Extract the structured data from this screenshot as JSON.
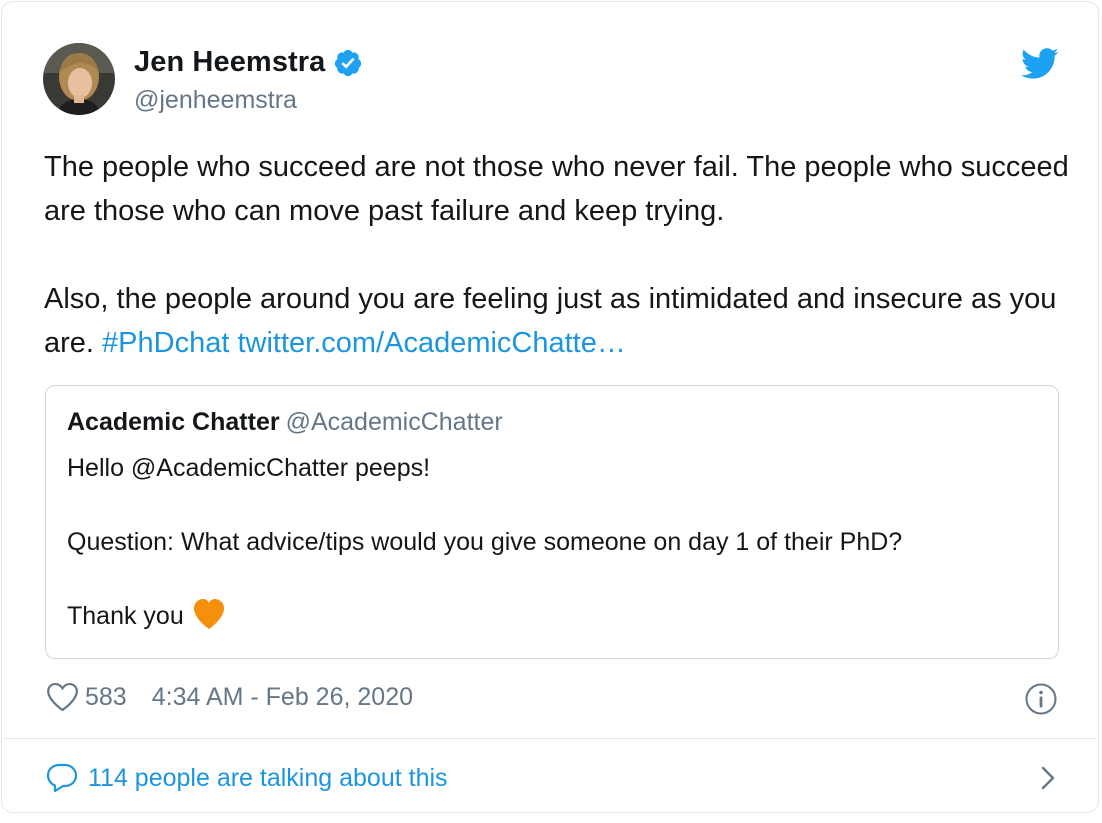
{
  "author": {
    "name": "Jen Heemstra",
    "handle": "@jenheemstra",
    "verified": true
  },
  "tweet": {
    "text_line1": "The people who succeed are not those who never fail. The people who succeed are those who can move past failure and keep trying.",
    "text_line2": "Also, the people around you are feeling just as intimidated and insecure as you are. ",
    "hashtag": "#PhDchat",
    "link": "twitter.com/AcademicChatte…"
  },
  "quoted_tweet": {
    "name": "Academic Chatter",
    "handle": "@AcademicChatter",
    "line1": "Hello @AcademicChatter peeps!",
    "line2": "Question: What advice/tips would you give someone on day 1 of their PhD?",
    "line3": "Thank you",
    "emoji": "orange-heart"
  },
  "meta": {
    "likes": "583",
    "timestamp": "4:34 AM - Feb 26, 2020"
  },
  "conversation": {
    "label": "114 people are talking about this"
  },
  "colors": {
    "link": "#1b95e0",
    "secondary_text": "#657786",
    "verified_badge": "#1da1f2",
    "emoji_heart": "#f4900c"
  }
}
